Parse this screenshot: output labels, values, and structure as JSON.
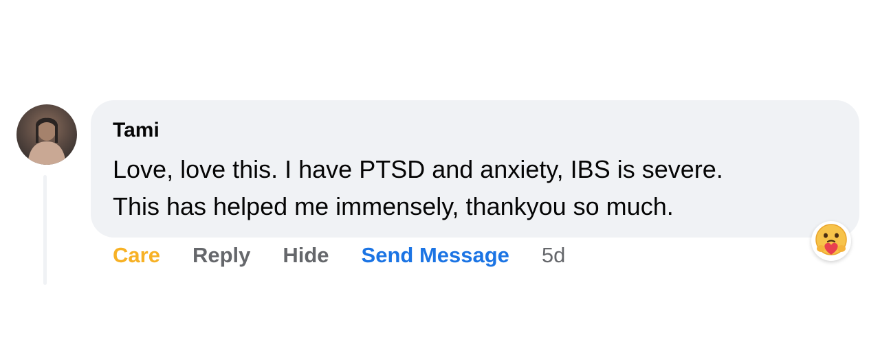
{
  "comment": {
    "author": "Tami",
    "text_lines": [
      "Love, love this. I have PTSD and anxiety, IBS is severe.",
      "This has helped me immensely, thankyou so much."
    ],
    "timestamp": "5d",
    "avatar_icon": "user-avatar-photo",
    "reaction_icon": "care-reaction-icon"
  },
  "actions": {
    "care_label": "Care",
    "reply_label": "Reply",
    "hide_label": "Hide",
    "send_message_label": "Send Message"
  },
  "colors": {
    "bubble": "#f0f2f5",
    "care": "#f7b125",
    "secondary_text": "#65676b",
    "link": "#1b74e4",
    "primary_text": "#050505"
  }
}
